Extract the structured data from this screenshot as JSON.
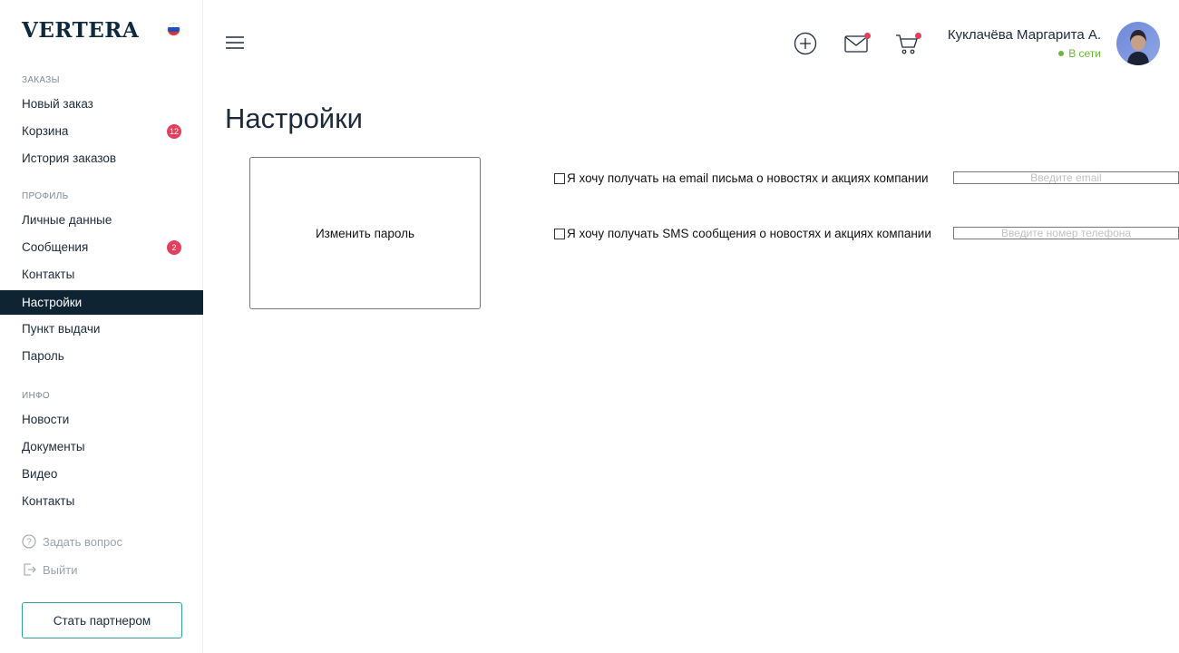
{
  "brand": {
    "logo_text": "VERTERA"
  },
  "sidebar": {
    "sections": [
      {
        "label": "ЗАКАЗЫ",
        "items": [
          {
            "label": "Новый заказ"
          },
          {
            "label": "Корзина",
            "badge": "12"
          },
          {
            "label": "История заказов"
          }
        ]
      },
      {
        "label": "ПРОФИЛЬ",
        "items": [
          {
            "label": "Личные данные"
          },
          {
            "label": "Сообщения",
            "badge": "2"
          },
          {
            "label": "Контакты"
          },
          {
            "label": "Настройки",
            "active": true
          },
          {
            "label": "Пункт выдачи"
          },
          {
            "label": "Пароль"
          }
        ]
      },
      {
        "label": "ИНФО",
        "items": [
          {
            "label": "Новости"
          },
          {
            "label": "Документы"
          },
          {
            "label": "Видео"
          },
          {
            "label": "Контакты"
          }
        ]
      }
    ],
    "ask_question": "Задать вопрос",
    "logout": "Выйти",
    "partner_button": "Стать партнером"
  },
  "header": {
    "user_name": "Куклачёва Маргарита А.",
    "user_status": "В сети",
    "icons": [
      "menu-icon",
      "add-circle-icon",
      "mail-icon",
      "cart-icon"
    ]
  },
  "main": {
    "title": "Настройки",
    "change_password_button": "Изменить пароль",
    "email_option": {
      "label": "Я хочу получать на email письма о новостях и акциях компании",
      "checked": false,
      "input_placeholder": "Введите email",
      "input_value": ""
    },
    "sms_option": {
      "label": "Я хочу получать SMS сообщения о новостях и акциях компании",
      "checked": false,
      "input_placeholder": "Введите номер телефона",
      "input_value": ""
    }
  },
  "colors": {
    "active_nav_bg": "#0f2433",
    "badge": "#e3405e",
    "online": "#6db33f",
    "partner_border": "#2fa39a"
  }
}
